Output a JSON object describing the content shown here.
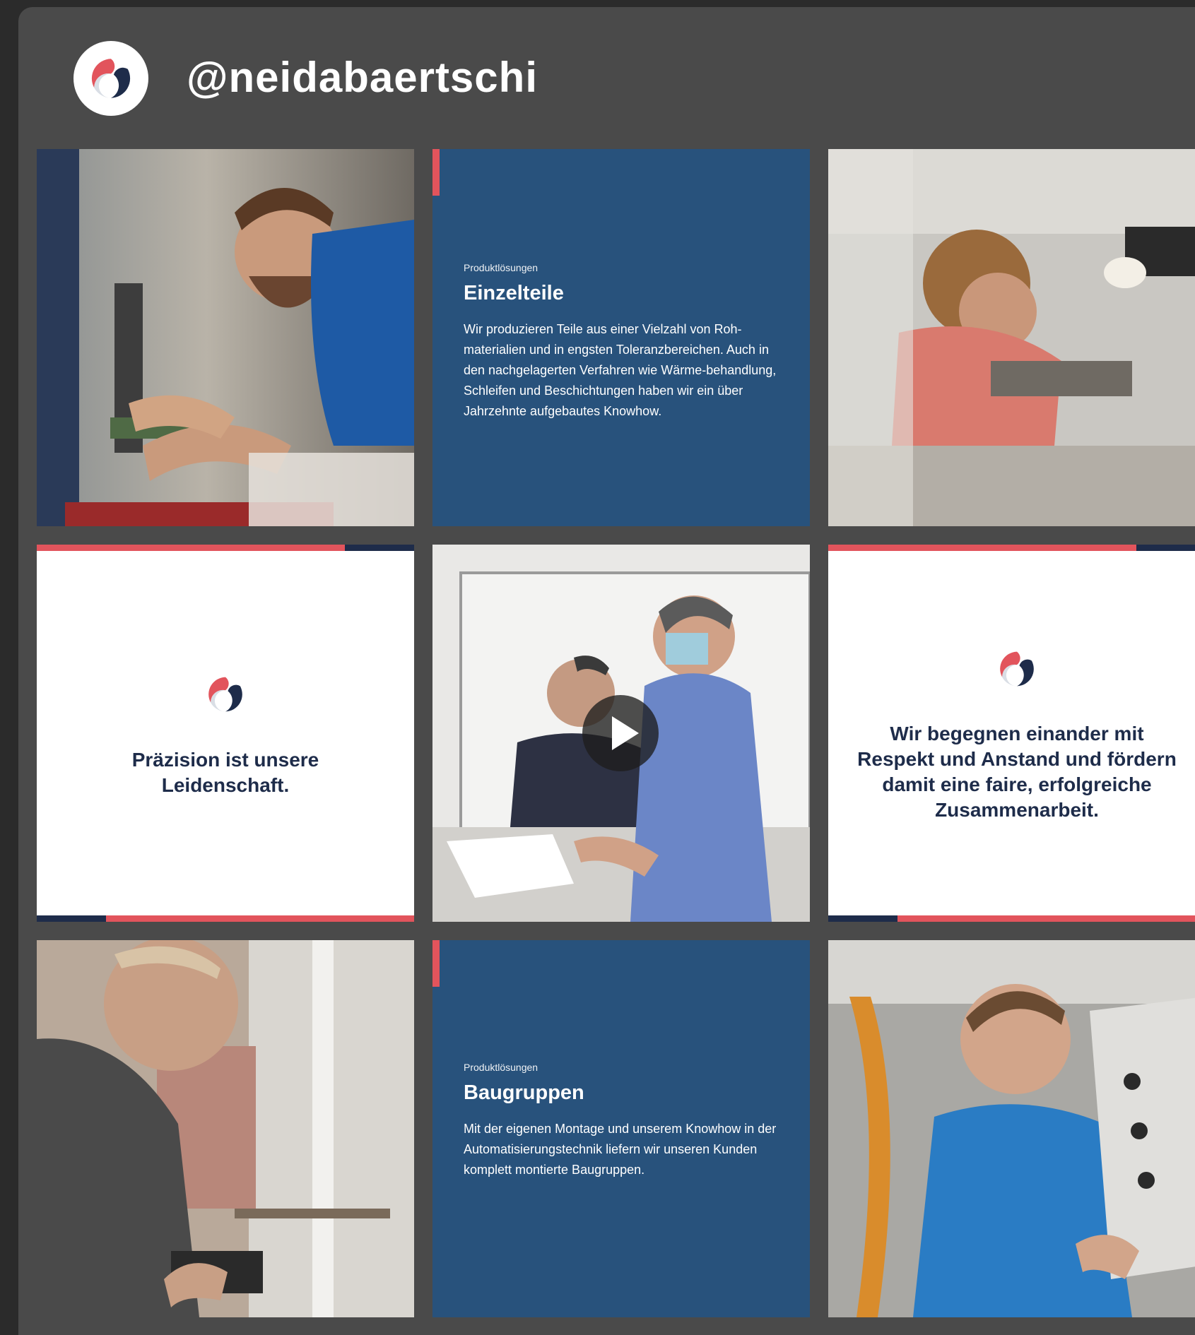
{
  "profile": {
    "handle": "@neidabaertschi",
    "avatar_icon": "spiral-logo-icon"
  },
  "colors": {
    "navy": "#28527c",
    "red": "#e2545c",
    "dark_navy": "#1e2c4a",
    "panel": "#4a4a4a"
  },
  "grid": {
    "row1": {
      "photo_left": {
        "icon": "worker-measuring-photo"
      },
      "text_card": {
        "eyebrow": "Produktlösungen",
        "title": "Einzelteile",
        "body": "Wir produzieren Teile aus einer Vielzahl von Roh-materialien und in engsten Toleranzbereichen. Auch in den nachgelagerten Verfahren wie Wärme-behandlung, Schleifen und Beschichtungen haben wir ein über Jahrzehnte aufgebautes Knowhow."
      },
      "photo_right": {
        "icon": "woman-inspecting-photo"
      }
    },
    "row2": {
      "quote_left": {
        "text": "Präzision ist unsere Leidenschaft.",
        "icon": "spiral-logo-icon"
      },
      "video": {
        "icon": "two-men-discussing-photo",
        "play_icon": "play-icon"
      },
      "quote_right": {
        "text": "Wir begegnen einander mit Respekt und Anstand und fördern damit eine faire, erfolgreiche Zusammenarbeit.",
        "icon": "spiral-logo-icon"
      }
    },
    "row3": {
      "photo_left": {
        "icon": "worker-with-drill-photo"
      },
      "text_card": {
        "eyebrow": "Produktlösungen",
        "title": "Baugruppen",
        "body": "Mit der eigenen Montage und unserem Knowhow in der Automatisierungstechnik liefern wir unseren Kunden komplett montierte Baugruppen."
      },
      "photo_right": {
        "icon": "worker-blue-shirt-photo"
      }
    }
  }
}
